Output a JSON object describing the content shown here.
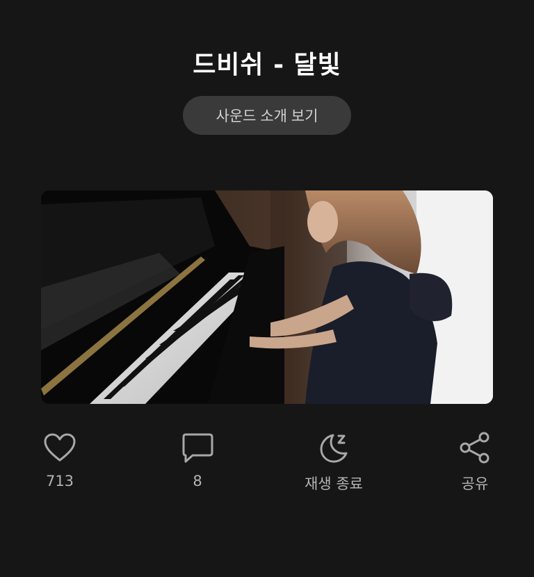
{
  "header": {
    "title": "드비쉬 - 달빛",
    "intro_button_label": "사운드 소개 보기"
  },
  "media": {
    "icon": "video-thumbnail"
  },
  "actions": [
    {
      "icon": "heart-icon",
      "label": "713"
    },
    {
      "icon": "comment-icon",
      "label": "8"
    },
    {
      "icon": "sleep-timer-icon",
      "label": "재생 종료"
    },
    {
      "icon": "share-icon",
      "label": "공유"
    }
  ],
  "colors": {
    "background": "#161616",
    "button_bg": "#3a3a3a",
    "icon": "#a8a8a8",
    "label": "#b4b4b4"
  }
}
